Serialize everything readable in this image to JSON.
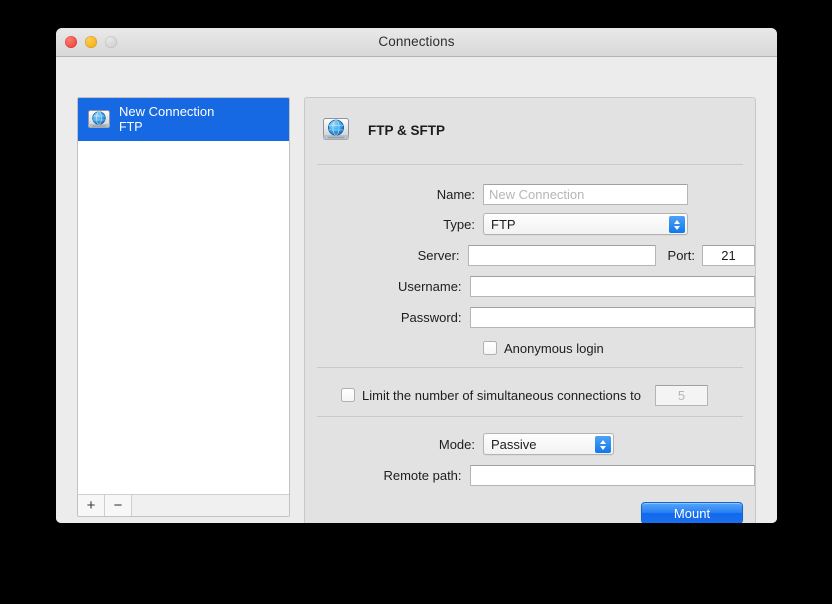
{
  "window": {
    "title": "Connections",
    "traffic_lights": [
      "close-button",
      "minimize-button",
      "zoom-button"
    ]
  },
  "sidebar": {
    "connections": [
      {
        "name": "New Connection",
        "protocol": "FTP",
        "icon": "network-disk-icon",
        "selected": true
      }
    ],
    "footer": {
      "add_label": "+",
      "remove_label": "−"
    }
  },
  "detail": {
    "header": {
      "icon": "network-disk-icon",
      "title": "FTP & SFTP"
    },
    "fields": {
      "name": {
        "label": "Name:",
        "value": "",
        "placeholder": "New Connection"
      },
      "type": {
        "label": "Type:",
        "value": "FTP"
      },
      "server": {
        "label": "Server:",
        "value": "",
        "placeholder": ""
      },
      "port": {
        "label": "Port:",
        "value": "21"
      },
      "username": {
        "label": "Username:",
        "value": "",
        "placeholder": ""
      },
      "password": {
        "label": "Password:",
        "value": "",
        "placeholder": ""
      },
      "anonymous_login": {
        "label": "Anonymous login",
        "checked": false
      },
      "limit_connections": {
        "label": "Limit the number of simultaneous connections to",
        "checked": false,
        "value": "5",
        "disabled": true
      },
      "mode": {
        "label": "Mode:",
        "value": "Passive"
      },
      "remote_path": {
        "label": "Remote path:",
        "value": "",
        "placeholder": ""
      }
    },
    "mount_button": "Mount"
  },
  "colors": {
    "selection_blue": "#1668e3",
    "accent_blue": "#1277ec",
    "window_bg": "#ececec",
    "panel_bg": "#e2e2e2"
  }
}
